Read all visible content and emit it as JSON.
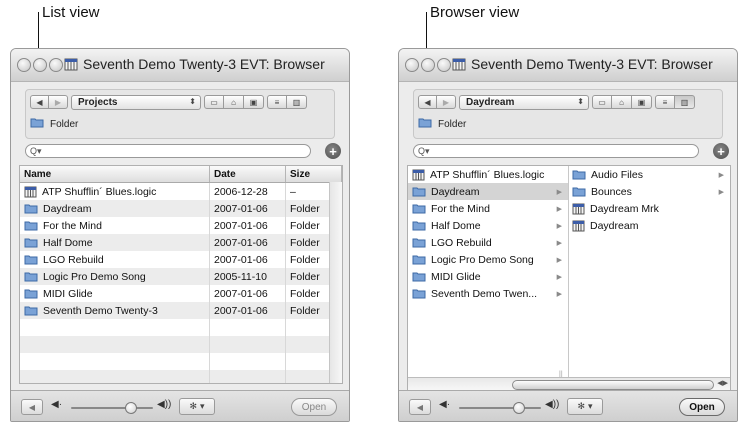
{
  "callouts": {
    "list": "List view",
    "browser": "Browser view"
  },
  "list_window": {
    "title": "Seventh Demo Twenty-3 EVT: Browser",
    "popup": "Projects",
    "folder_label": "Folder",
    "search_placeholder": "Q▾",
    "columns": [
      "Name",
      "Date",
      "Size"
    ],
    "rows": [
      {
        "name": "ATP Shufflin´ Blues.logic",
        "date": "2006-12-28",
        "size": "–",
        "icon": "logic-file-icon"
      },
      {
        "name": "Daydream",
        "date": "2007-01-06",
        "size": "Folder",
        "icon": "folder-icon"
      },
      {
        "name": "For the Mind",
        "date": "2007-01-06",
        "size": "Folder",
        "icon": "folder-icon"
      },
      {
        "name": "Half Dome",
        "date": "2007-01-06",
        "size": "Folder",
        "icon": "folder-icon"
      },
      {
        "name": "LGO Rebuild",
        "date": "2007-01-06",
        "size": "Folder",
        "icon": "folder-icon"
      },
      {
        "name": "Logic Pro Demo Song",
        "date": "2005-11-10",
        "size": "Folder",
        "icon": "folder-icon"
      },
      {
        "name": "MIDI Glide",
        "date": "2007-01-06",
        "size": "Folder",
        "icon": "folder-icon"
      },
      {
        "name": "Seventh Demo Twenty-3",
        "date": "2007-01-06",
        "size": "Folder",
        "icon": "folder-icon"
      }
    ],
    "open_label": "Open"
  },
  "browser_window": {
    "title": "Seventh Demo Twenty-3 EVT: Browser",
    "popup": "Daydream",
    "folder_label": "Folder",
    "search_placeholder": "Q▾",
    "col1": [
      {
        "name": "ATP Shufflin´ Blues.logic",
        "icon": "logic-file-icon",
        "chev": false,
        "selected": false
      },
      {
        "name": "Daydream",
        "icon": "folder-icon",
        "chev": true,
        "selected": true
      },
      {
        "name": "For the Mind",
        "icon": "folder-icon",
        "chev": true,
        "selected": false
      },
      {
        "name": "Half Dome",
        "icon": "folder-icon",
        "chev": true,
        "selected": false
      },
      {
        "name": "LGO Rebuild",
        "icon": "folder-icon",
        "chev": true,
        "selected": false
      },
      {
        "name": "Logic Pro Demo Song",
        "icon": "folder-icon",
        "chev": true,
        "selected": false
      },
      {
        "name": "MIDI Glide",
        "icon": "folder-icon",
        "chev": true,
        "selected": false
      },
      {
        "name": "Seventh Demo Twen...",
        "icon": "folder-icon",
        "chev": true,
        "selected": false
      }
    ],
    "col2": [
      {
        "name": "Audio Files",
        "icon": "folder-icon",
        "chev": true
      },
      {
        "name": "Bounces",
        "icon": "folder-icon",
        "chev": true
      },
      {
        "name": "Daydream Mrk",
        "icon": "logic-file-icon",
        "chev": false
      },
      {
        "name": "Daydream",
        "icon": "logic-file-icon",
        "chev": false
      }
    ],
    "open_label": "Open"
  }
}
